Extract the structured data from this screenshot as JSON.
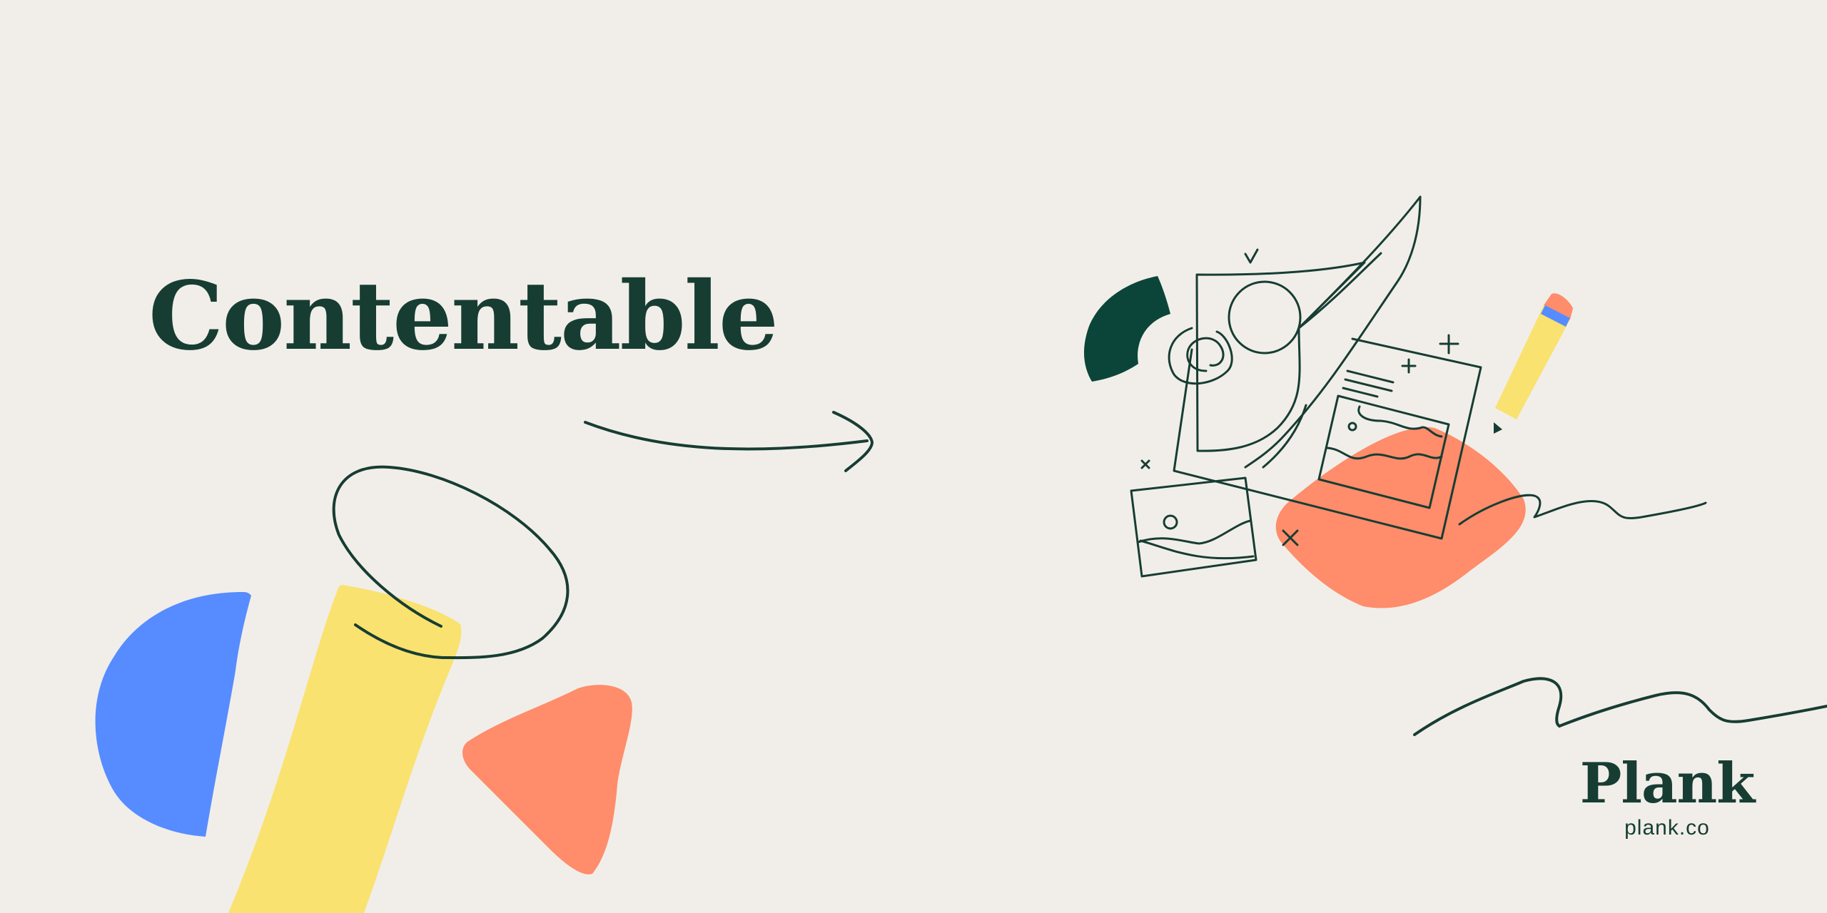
{
  "hero": {
    "title": "Contentable"
  },
  "brand": {
    "name": "Plank",
    "url": "plank.co"
  },
  "colors": {
    "background": "#f1eee9",
    "ink": "#173d33",
    "blue": "#568cff",
    "yellow": "#f9e26f",
    "coral": "#ff8c6a",
    "dark_green": "#0b4539"
  },
  "icons": {
    "illustration": "document-collage-illustration",
    "pencil": "pencil-icon",
    "arrow": "curved-arrow",
    "blobs": "abstract-shape-blobs"
  }
}
